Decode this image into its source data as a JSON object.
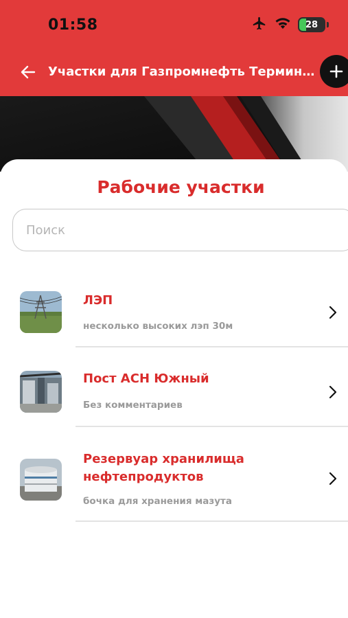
{
  "status_bar": {
    "time": "01:58",
    "battery": "28",
    "icons": [
      "airplane-icon",
      "wifi-icon",
      "battery-charging-icon"
    ]
  },
  "header": {
    "title": "Участки для Газпромнефть Терминал...",
    "back_icon": "arrow-left-icon",
    "add_icon": "plus-icon"
  },
  "sheet": {
    "title": "Рабочие участки",
    "search": {
      "placeholder": "Поиск",
      "value": ""
    }
  },
  "items": [
    {
      "title": "ЛЭП",
      "subtitle": "несколько высоких лэп 30м",
      "thumbnail": "power-line-photo"
    },
    {
      "title": "Пост АСН Южный",
      "subtitle": "Без комментариев",
      "thumbnail": "station-photo"
    },
    {
      "title": "Резервуар хранилища нефтепродуктов",
      "title_line1": "Резервуар хранилища",
      "title_line2": "нефтепродуктов",
      "subtitle": "бочка для хранения мазута",
      "thumbnail": "tank-photo"
    }
  ],
  "colors": {
    "header_red": "#e23a3a",
    "accent_red": "#d92c2c",
    "subtitle_gray": "#9a9a9a"
  }
}
